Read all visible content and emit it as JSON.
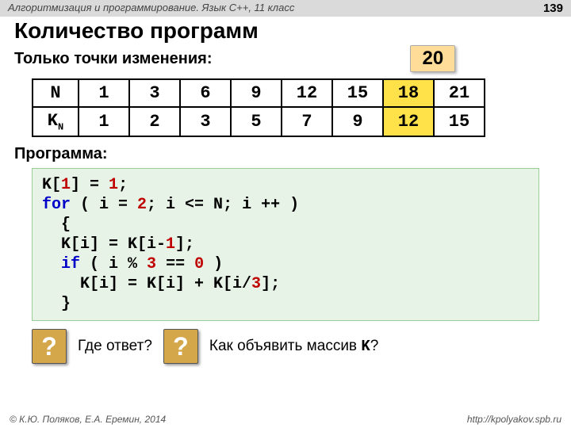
{
  "header": {
    "title": "Алгоритмизация и программирование. Язык C++, 11 класс",
    "page": "139"
  },
  "h1": "Количество программ",
  "subtitle": "Только точки изменения:",
  "badge": "20",
  "table": {
    "row1": [
      "N",
      "1",
      "3",
      "6",
      "9",
      "12",
      "15",
      "18",
      "21"
    ],
    "row2": [
      "K",
      "1",
      "2",
      "3",
      "5",
      "7",
      "9",
      "12",
      "15"
    ],
    "ksub": "N"
  },
  "progLabel": "Программа:",
  "code": {
    "l1a": "K[",
    "l1b": "1",
    "l1c": "] = ",
    "l1d": "1",
    "l1e": ";",
    "l2a": "for",
    "l2b": " ( i = ",
    "l2c": "2",
    "l2d": "; i <= N; i ++ )",
    "l3": "  {",
    "l4a": "  K[i] = K[i-",
    "l4b": "1",
    "l4c": "];",
    "l5a": "  ",
    "l5b": "if",
    "l5c": " ( i % ",
    "l5d": "3",
    "l5e": " == ",
    "l5f": "0",
    "l5g": " )",
    "l6a": "    K[i] = K[i] + K[i/",
    "l6b": "3",
    "l6c": "];",
    "l7": "  }"
  },
  "q1": "Где ответ?",
  "q2a": "Как объявить массив ",
  "q2b": "K",
  "q2c": "?",
  "qmark": "?",
  "footer": {
    "left": "© К.Ю. Поляков, Е.А. Еремин, 2014",
    "right": "http://kpolyakov.spb.ru"
  }
}
